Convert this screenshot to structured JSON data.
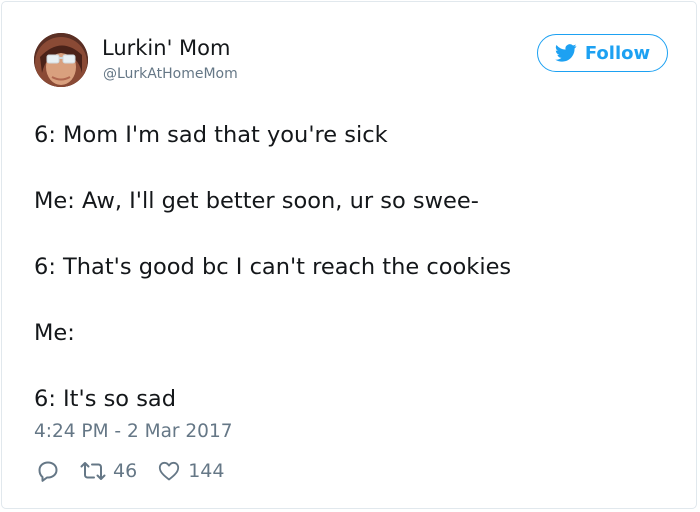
{
  "author": {
    "display_name": "Lurkin' Mom",
    "handle": "@LurkAtHomeMom"
  },
  "follow_button": {
    "label": "Follow",
    "icon": "twitter-bird-icon",
    "color": "#1da1f2"
  },
  "tweet": {
    "lines": [
      "6: Mom I'm sad that you're sick",
      "Me: Aw, I'll get better soon, ur so swee-",
      "6: That's good bc I can't reach the cookies",
      "Me:",
      "6: It's so sad"
    ],
    "timestamp": "4:24 PM - 2 Mar 2017"
  },
  "actions": {
    "reply": {
      "icon": "reply-icon"
    },
    "retweet": {
      "icon": "retweet-icon",
      "count": "46"
    },
    "like": {
      "icon": "heart-icon",
      "count": "144"
    }
  },
  "colors": {
    "text_primary": "#14171a",
    "text_secondary": "#657786",
    "accent": "#1da1f2",
    "border": "#e1e8ed"
  }
}
